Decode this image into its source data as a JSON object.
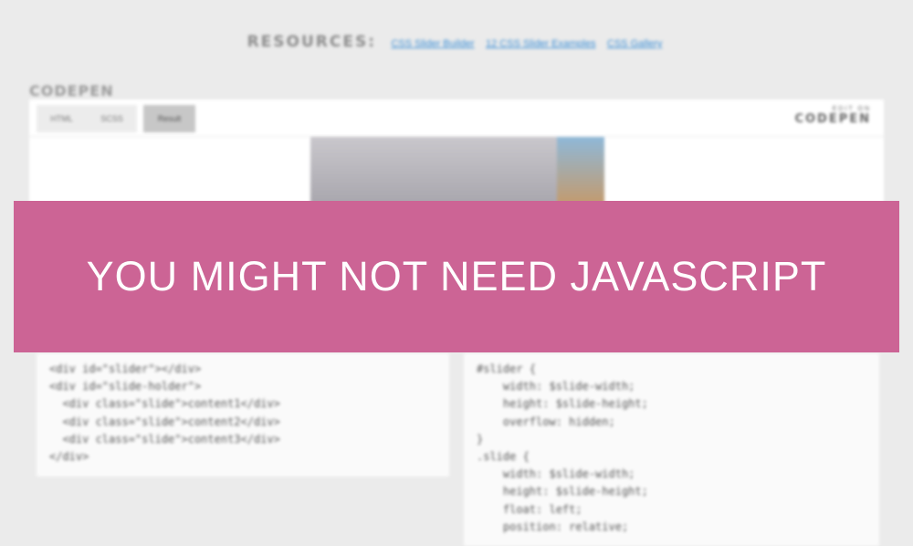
{
  "resources": {
    "label": "RESOURCES:",
    "links": [
      "CSS Slider Builder",
      "12 CSS Slider Examples",
      "CSS Gallery"
    ]
  },
  "codepen": {
    "title": "CODEPEN",
    "tabs": [
      "HTML",
      "SCSS",
      "Result"
    ],
    "active_tab": "Result",
    "edit_on": "EDIT ON",
    "brand": "CODEPEN"
  },
  "html_code": [
    "<div id=\"slider\"></div>",
    "<div id=\"slide-holder\">",
    "  <div class=\"slide\">content1</div>",
    "  <div class=\"slide\">content2</div>",
    "  <div class=\"slide\">content3</div>",
    "</div>"
  ],
  "scss_code": [
    "#slider {",
    "    width: $slide-width;",
    "    height: $slide-height;",
    "    overflow: hidden;",
    "}",
    "",
    ".slide {",
    "    width: $slide-width;",
    "    height: $slide-height;",
    "    float: left;",
    "    position: relative;"
  ],
  "banner": {
    "text": "YOU MIGHT NOT NEED JAVASCRIPT"
  },
  "colors": {
    "banner": "#cc6495",
    "link": "#3a8ed6",
    "background": "#ebebeb"
  }
}
